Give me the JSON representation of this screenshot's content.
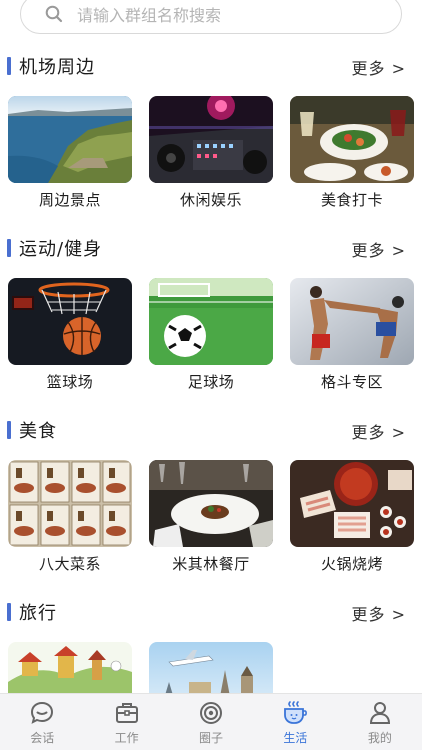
{
  "search": {
    "placeholder": "请输入群组名称搜索",
    "icon": "search-icon"
  },
  "sections": [
    {
      "title": "机场周边",
      "more": "更多 >",
      "items": [
        {
          "label": "周边景点"
        },
        {
          "label": "休闲娱乐"
        },
        {
          "label": "美食打卡"
        }
      ]
    },
    {
      "title": "运动/健身",
      "more": "更多 >",
      "items": [
        {
          "label": "篮球场"
        },
        {
          "label": "足球场"
        },
        {
          "label": "格斗专区"
        }
      ]
    },
    {
      "title": "美食",
      "more": "更多 >",
      "items": [
        {
          "label": "八大菜系"
        },
        {
          "label": "米其林餐厅"
        },
        {
          "label": "火锅烧烤"
        }
      ]
    },
    {
      "title": "旅行",
      "more": "更多 >",
      "items": [
        {
          "label": ""
        },
        {
          "label": ""
        }
      ]
    }
  ],
  "tabbar": {
    "active_color": "#3a74d8",
    "tabs": [
      {
        "label": "会话",
        "icon": "chat-icon"
      },
      {
        "label": "工作",
        "icon": "briefcase-icon"
      },
      {
        "label": "圈子",
        "icon": "circle-icon"
      },
      {
        "label": "生活",
        "icon": "coffee-cup-icon",
        "active": true
      },
      {
        "label": "我的",
        "icon": "person-icon"
      }
    ]
  }
}
